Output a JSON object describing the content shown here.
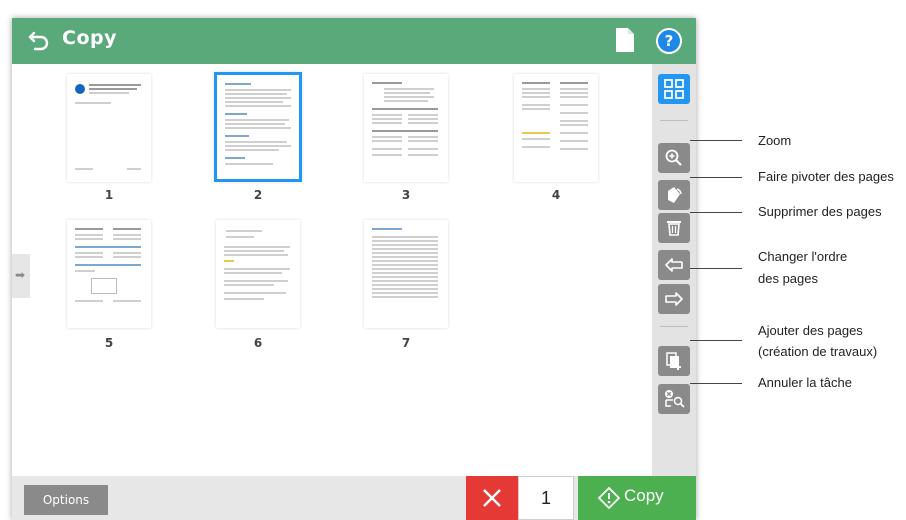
{
  "header": {
    "title": "Copy",
    "back_icon": "back-arrow-icon",
    "document_icon": "document-icon",
    "help_glyph": "?"
  },
  "pages": [
    {
      "number": "1",
      "selected": false
    },
    {
      "number": "2",
      "selected": true
    },
    {
      "number": "3",
      "selected": false
    },
    {
      "number": "4",
      "selected": false
    },
    {
      "number": "5",
      "selected": false
    },
    {
      "number": "6",
      "selected": false
    },
    {
      "number": "7",
      "selected": false
    }
  ],
  "toolbar": {
    "items": [
      "grid-view-icon",
      "zoom-icon",
      "rotate-icon",
      "delete-icon",
      "move-left-icon",
      "move-right-icon",
      "add-pages-icon",
      "cancel-job-icon"
    ]
  },
  "bottom": {
    "options_label": "Options",
    "copies_value": "1",
    "copy_label": "Copy"
  },
  "callouts": {
    "zoom": "Zoom",
    "rotate": "Faire pivoter des pages",
    "delete": "Supprimer des pages",
    "reorder_line1": "Changer l'ordre",
    "reorder_line2": "des pages",
    "add_line1": "Ajouter des pages",
    "add_line2": "(création de travaux)",
    "cancel": "Annuler la tâche"
  },
  "colors": {
    "header_green": "#5aa97a",
    "selection_blue": "#2196f3",
    "cancel_red": "#e53935",
    "copy_green": "#4caf50",
    "toolbar_button_gray": "#8a8a8a"
  }
}
